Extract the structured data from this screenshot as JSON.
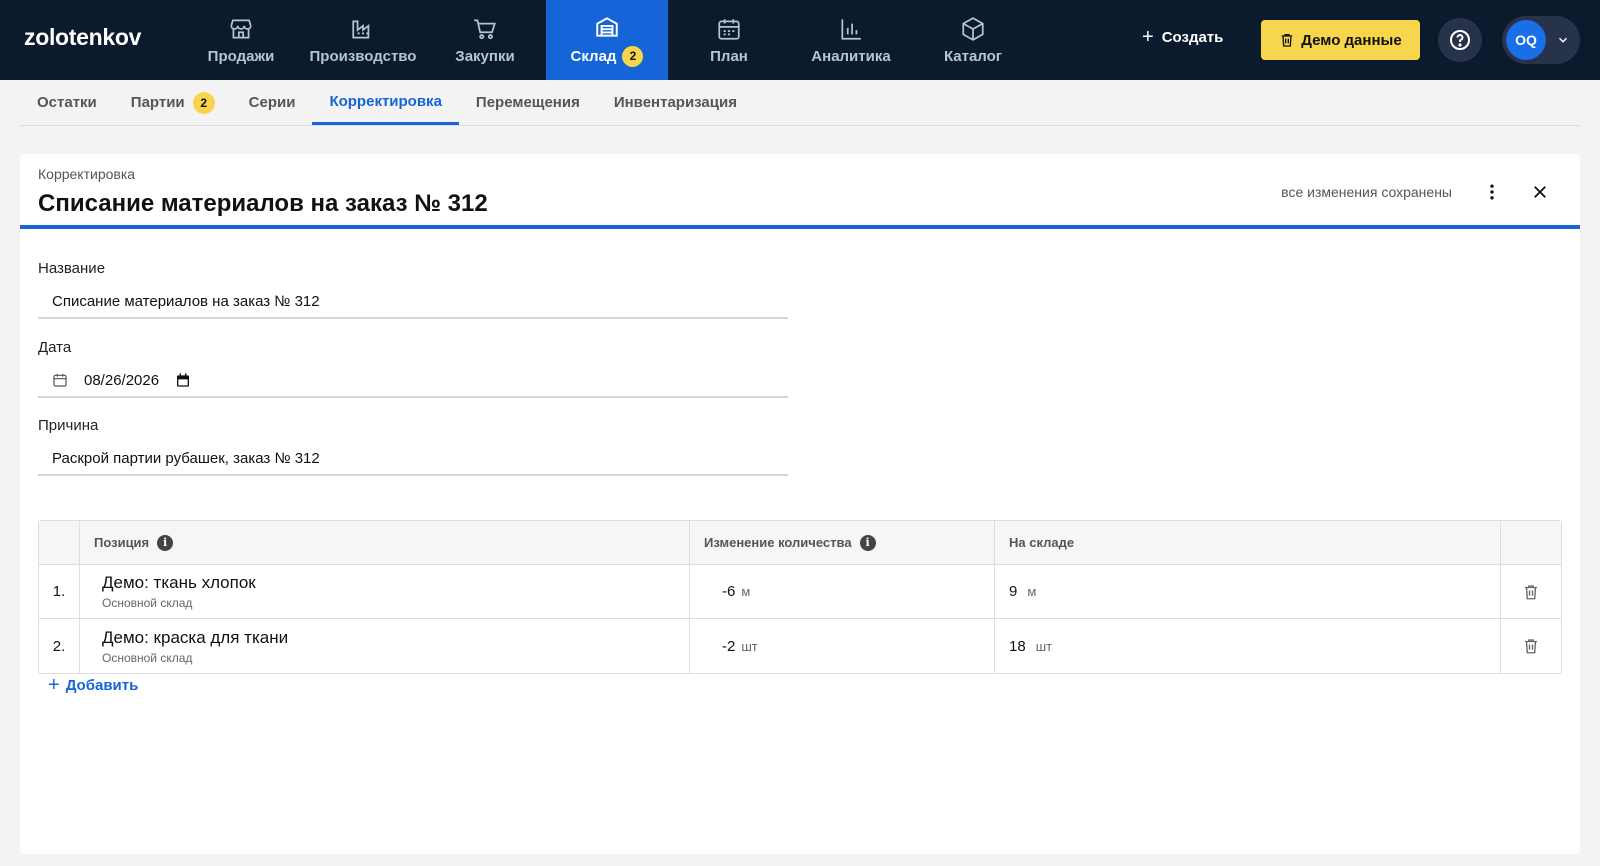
{
  "app": {
    "logo": "zolotenkov"
  },
  "nav": {
    "items": [
      {
        "label": "Продажи",
        "icon": "store-icon"
      },
      {
        "label": "Производство",
        "icon": "factory-icon"
      },
      {
        "label": "Закупки",
        "icon": "cart-icon"
      },
      {
        "label": "Склад",
        "icon": "warehouse-icon",
        "badge": "2",
        "active": true
      },
      {
        "label": "План",
        "icon": "calendar-icon"
      },
      {
        "label": "Аналитика",
        "icon": "bar-chart-icon"
      },
      {
        "label": "Каталог",
        "icon": "box-icon"
      }
    ],
    "create_label": "Создать",
    "demo_label": "Демо данные",
    "avatar_initials": "OQ"
  },
  "subtabs": [
    {
      "label": "Остатки"
    },
    {
      "label": "Партии",
      "badge": "2"
    },
    {
      "label": "Серии"
    },
    {
      "label": "Корректировка",
      "active": true
    },
    {
      "label": "Перемещения"
    },
    {
      "label": "Инвентаризация"
    }
  ],
  "card": {
    "breadcrumb": "Корректировка",
    "title": "Списание материалов на заказ № 312",
    "saved_status": "все изменения сохранены"
  },
  "form": {
    "name_label": "Название",
    "name_value": "Списание материалов на заказ № 312",
    "date_label": "Дата",
    "date_value": "08/26/2026",
    "reason_label": "Причина",
    "reason_value": "Раскрой партии рубашек, заказ № 312"
  },
  "table": {
    "headers": {
      "position": "Позиция",
      "change": "Изменение количества",
      "stock": "На складе"
    },
    "rows": [
      {
        "num": "1.",
        "name": "Демо: ткань хлопок",
        "warehouse": "Основной склад",
        "change": "-6",
        "change_unit": "м",
        "stock": "9",
        "stock_unit": "м"
      },
      {
        "num": "2.",
        "name": "Демо: краска для ткани",
        "warehouse": "Основной склад",
        "change": "-2",
        "change_unit": "шт",
        "stock": "18",
        "stock_unit": "шт"
      }
    ],
    "add_label": "Добавить"
  },
  "colors": {
    "topbar": "#0c1a2e",
    "accent": "#1565d8",
    "demo_button": "#f7d54c"
  }
}
